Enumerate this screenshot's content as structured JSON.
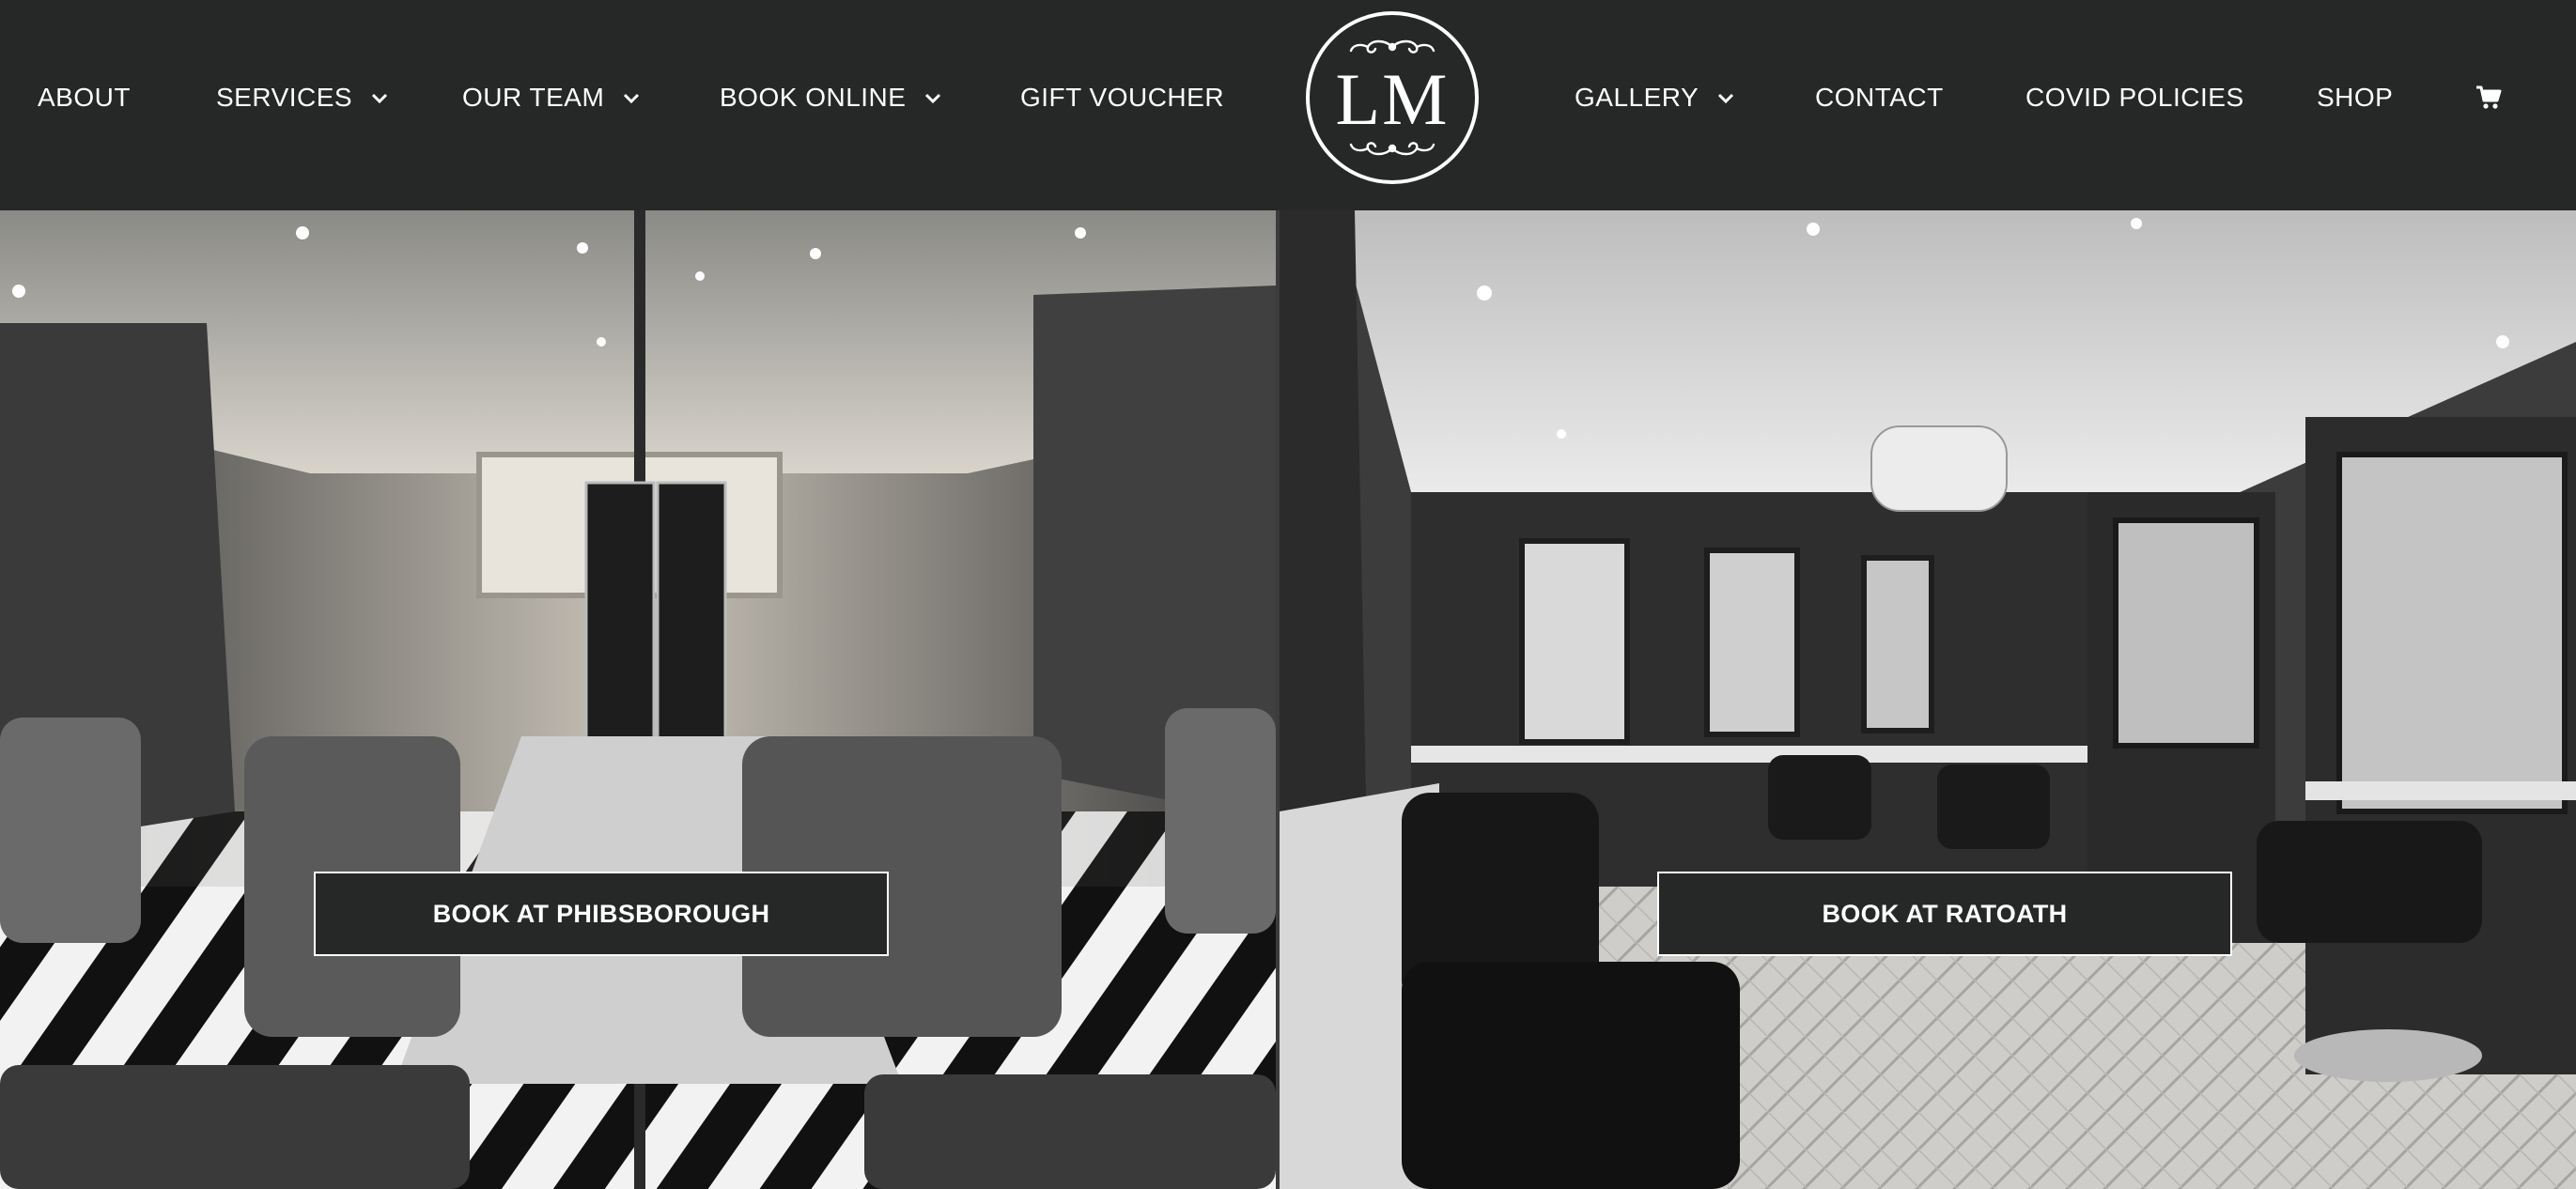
{
  "nav": {
    "left": [
      {
        "label": "ABOUT",
        "dropdown": false
      },
      {
        "label": "SERVICES",
        "dropdown": true
      },
      {
        "label": "OUR TEAM",
        "dropdown": true
      },
      {
        "label": "BOOK ONLINE",
        "dropdown": true
      },
      {
        "label": "GIFT VOUCHER",
        "dropdown": false
      }
    ],
    "right": [
      {
        "label": "GALLERY",
        "dropdown": true
      },
      {
        "label": "CONTACT",
        "dropdown": false
      },
      {
        "label": "COVID POLICIES",
        "dropdown": false
      },
      {
        "label": "SHOP",
        "dropdown": false
      }
    ],
    "cart_icon": "shopping-cart-icon"
  },
  "logo": {
    "text": "LM"
  },
  "panels": [
    {
      "button_label": "BOOK AT PHIBSBOROUGH"
    },
    {
      "button_label": "BOOK AT RATOATH"
    }
  ],
  "colors": {
    "header_bg": "#262727",
    "button_bg": "#262727",
    "text": "#ffffff"
  }
}
